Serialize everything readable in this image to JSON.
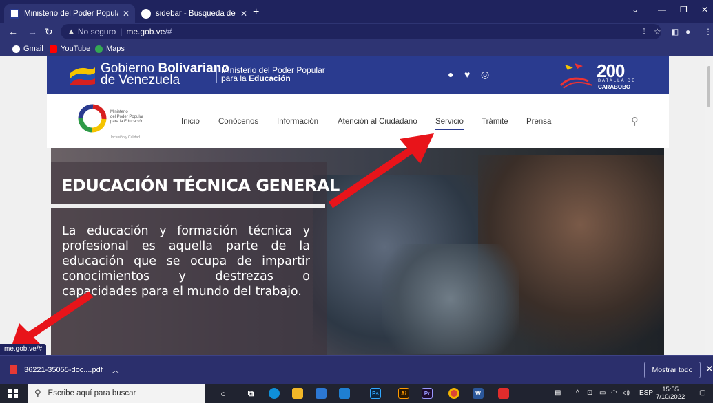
{
  "browser": {
    "tabs": [
      {
        "title": "Ministerio del Poder Popular para",
        "active": true
      },
      {
        "title": "sidebar - Búsqueda de Google",
        "active": false
      }
    ],
    "address": {
      "security": "No seguro",
      "host": "me.gob.ve",
      "path": "/#"
    },
    "bookmarks": [
      "Gmail",
      "YouTube",
      "Maps"
    ]
  },
  "site": {
    "gov_line1": "Gobierno",
    "gov_bold": "Bolivariano",
    "gov_line2": "de Venezuela",
    "ministry_line1": "Ministerio del Poder Popular",
    "ministry_line2_pre": "para la ",
    "ministry_line2_bold": "Educación",
    "bicentennial": {
      "number": "200",
      "label1": "BATALLA DE",
      "label2": "CARABOBO"
    },
    "logo_text": {
      "l1": "Ministerio",
      "l2": "del Poder Popular",
      "l3": "para la Educación",
      "tag": "Inclusión y Calidad"
    },
    "nav": [
      "Inicio",
      "Conócenos",
      "Información",
      "Atención al Ciudadano",
      "Servicio",
      "Trámite",
      "Prensa"
    ],
    "active_nav": "Servicio"
  },
  "hero": {
    "title": "EDUCACIÓN TÉCNICA GENERAL",
    "body": "La educación y formación técnica y profesional es aquella parte de la educación que se ocupa de impartir conocimientos y destrezas o capacidades para el mundo del trabajo."
  },
  "status_url": "me.gob.ve/#",
  "download": {
    "filename": "36221-35055-doc....pdf",
    "show_all": "Mostrar todo"
  },
  "taskbar": {
    "search_placeholder": "Escribe aquí para buscar",
    "lang": "ESP",
    "time": "15:55",
    "date": "7/10/2022"
  },
  "colors": {
    "gov_blue": "#2a3b8f",
    "chrome_dark": "#1f235e",
    "chrome": "#2e3473",
    "arrow_red": "#e8141a"
  }
}
